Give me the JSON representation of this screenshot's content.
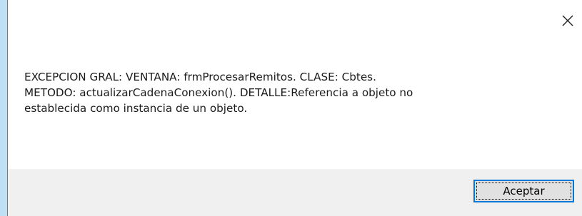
{
  "dialog": {
    "close_icon": "close-icon",
    "message_lines": [
      "EXCEPCION GRAL: VENTANA: frmProcesarRemitos. CLASE: Cbtes.",
      "METODO: actualizarCadenaConexion(). DETALLE:Referencia a objeto no",
      "establecida como instancia de un objeto."
    ],
    "ok_button_label": "Aceptar"
  },
  "colors": {
    "accent": "#0078d7",
    "footer_bg": "#f0f0f0",
    "button_bg": "#e1e1e1"
  }
}
